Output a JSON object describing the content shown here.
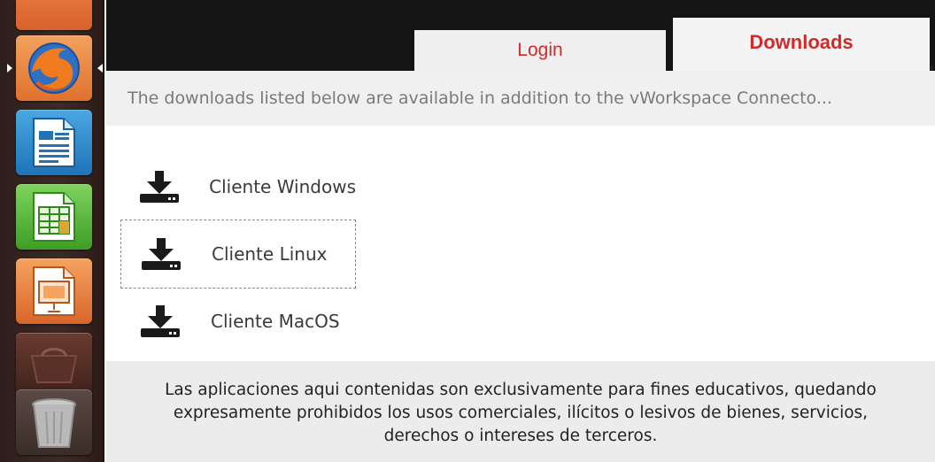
{
  "launcher": {
    "items": [
      {
        "name": "Firefox Web Browser",
        "icon": "firefox-icon"
      },
      {
        "name": "LibreOffice Writer",
        "icon": "writer-icon"
      },
      {
        "name": "LibreOffice Calc",
        "icon": "calc-icon"
      },
      {
        "name": "LibreOffice Impress",
        "icon": "impress-icon"
      },
      {
        "name": "Ubuntu Software Center",
        "icon": "software-center-icon"
      },
      {
        "name": "Trash",
        "icon": "trash-icon"
      }
    ]
  },
  "tabs": {
    "login": "Login",
    "downloads": "Downloads",
    "active": "downloads",
    "accent_color": "#d12a2a"
  },
  "info_text": "The downloads listed below are available in addition to the vWorkspace Connecto...",
  "downloads": [
    {
      "label": "Cliente Windows",
      "icon": "download-icon"
    },
    {
      "label": "Cliente Linux",
      "icon": "download-icon",
      "focused": true
    },
    {
      "label": "Cliente MacOS",
      "icon": "download-icon"
    }
  ],
  "footer": {
    "line1": "Las aplicaciones aqui contenidas son exclusivamente para fines educativos, quedando",
    "line2": "expresamente prohibidos los usos comerciales, ilícitos o lesivos de bienes, servicios,",
    "line3": "derechos o intereses de terceros."
  }
}
